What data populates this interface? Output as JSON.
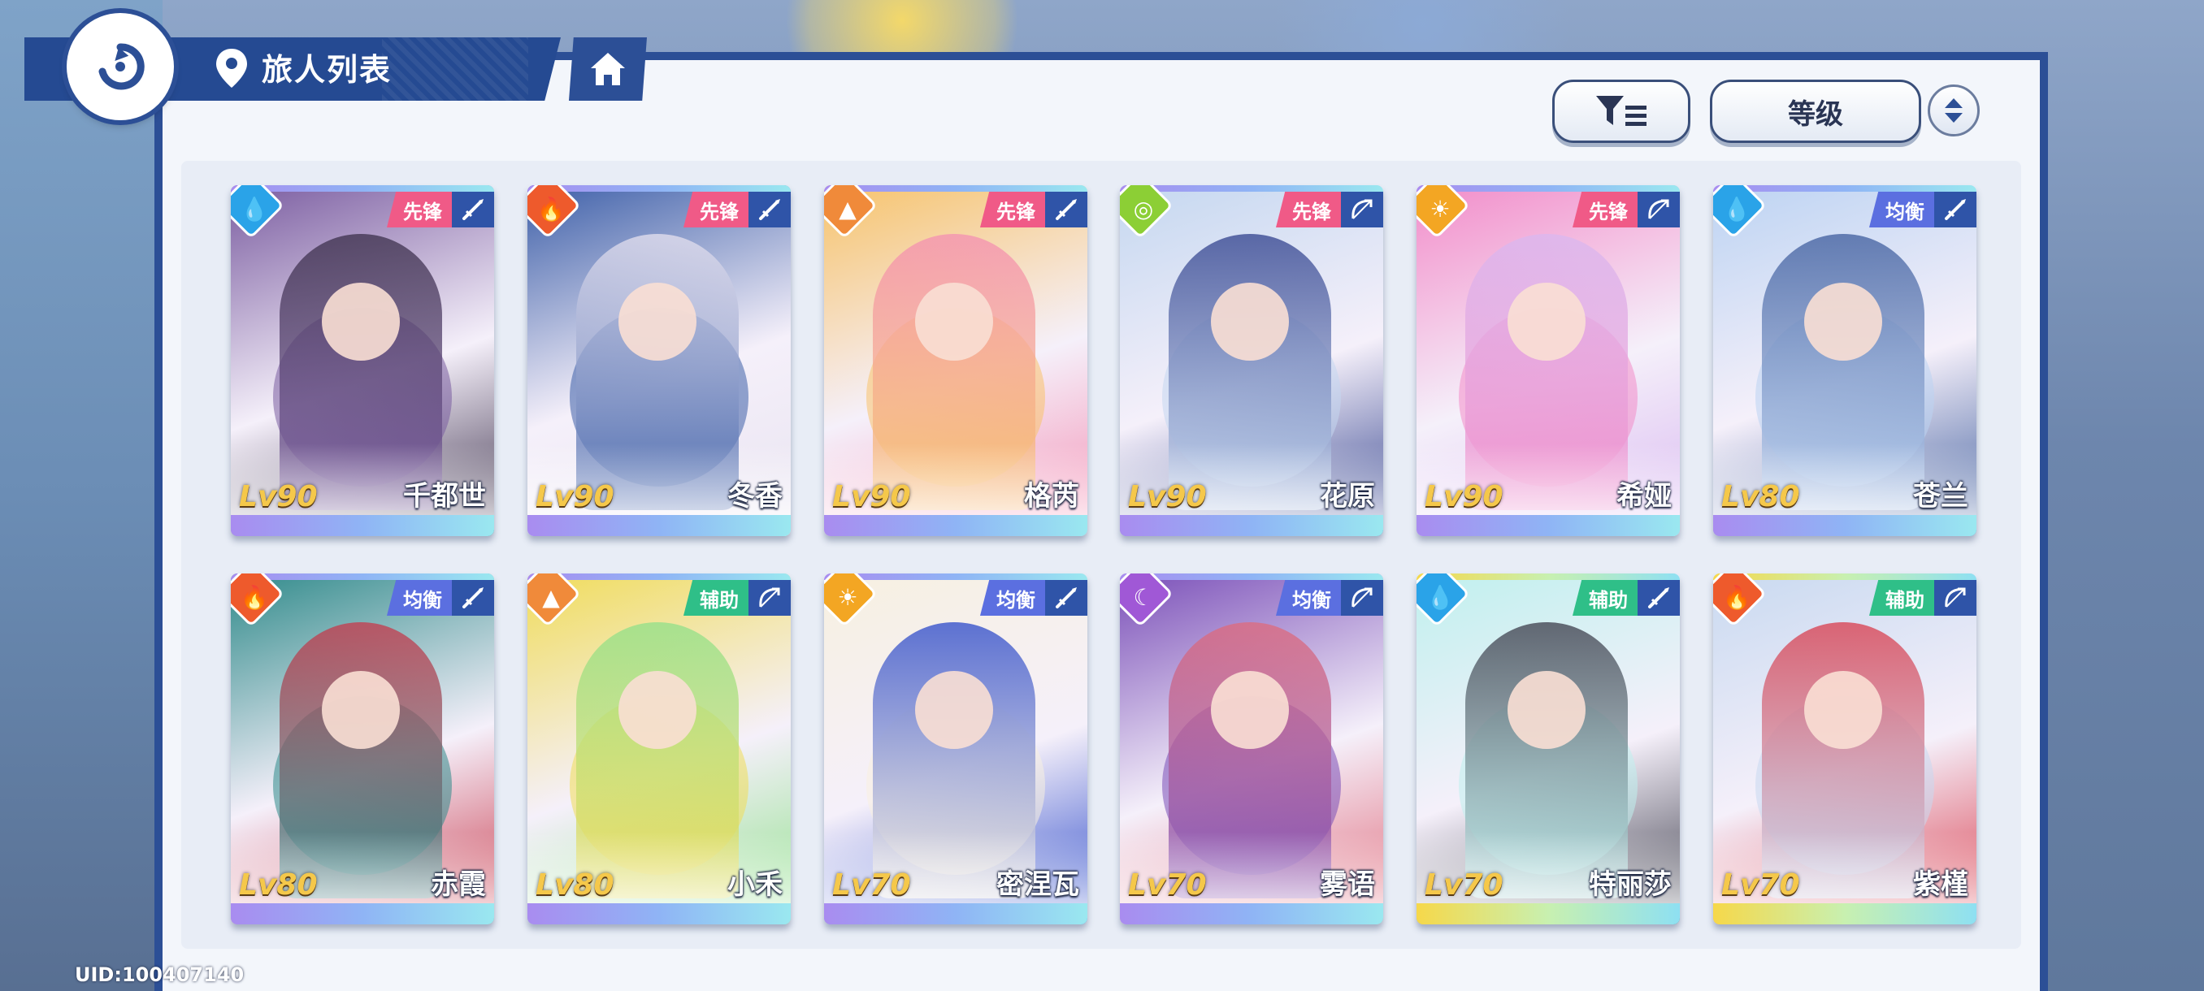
{
  "header": {
    "title": "旅人列表"
  },
  "toolbar": {
    "sort_label": "等级"
  },
  "icons": {
    "back": "back-arrow-icon",
    "location": "location-pin-icon",
    "home": "home-icon",
    "filter": "filter-icon",
    "sort_order": "sort-order-icon"
  },
  "colors": {
    "panel_border": "#2c4f96",
    "level_text": "#f5c84a",
    "role_vanguard": "#f05a87",
    "role_balance": "#5b6fe0",
    "role_support": "#2fbf88"
  },
  "characters": [
    {
      "name": "千都世",
      "level": "Lv90",
      "role": "先锋",
      "element": "water",
      "weapon": "sword",
      "rarity": "purple"
    },
    {
      "name": "冬香",
      "level": "Lv90",
      "role": "先锋",
      "element": "fire",
      "weapon": "sword",
      "rarity": "purple"
    },
    {
      "name": "格芮",
      "level": "Lv90",
      "role": "先锋",
      "element": "earth",
      "weapon": "sword",
      "rarity": "purple"
    },
    {
      "name": "花原",
      "level": "Lv90",
      "role": "先锋",
      "element": "wind",
      "weapon": "bow",
      "rarity": "purple"
    },
    {
      "name": "希娅",
      "level": "Lv90",
      "role": "先锋",
      "element": "light",
      "weapon": "bow",
      "rarity": "purple"
    },
    {
      "name": "苍兰",
      "level": "Lv80",
      "role": "均衡",
      "element": "water",
      "weapon": "sword",
      "rarity": "purple"
    },
    {
      "name": "赤霞",
      "level": "Lv80",
      "role": "均衡",
      "element": "fire",
      "weapon": "sword",
      "rarity": "purple"
    },
    {
      "name": "小禾",
      "level": "Lv80",
      "role": "辅助",
      "element": "earth",
      "weapon": "bow",
      "rarity": "purple"
    },
    {
      "name": "密涅瓦",
      "level": "Lv70",
      "role": "均衡",
      "element": "light",
      "weapon": "sword",
      "rarity": "purple"
    },
    {
      "name": "雾语",
      "level": "Lv70",
      "role": "均衡",
      "element": "dark",
      "weapon": "bow",
      "rarity": "purple"
    },
    {
      "name": "特丽莎",
      "level": "Lv70",
      "role": "辅助",
      "element": "water",
      "weapon": "sword",
      "rarity": "gold"
    },
    {
      "name": "紫槿",
      "level": "Lv70",
      "role": "辅助",
      "element": "fire",
      "weapon": "bow",
      "rarity": "gold"
    }
  ],
  "footer": {
    "uid": "UID:100407140"
  }
}
